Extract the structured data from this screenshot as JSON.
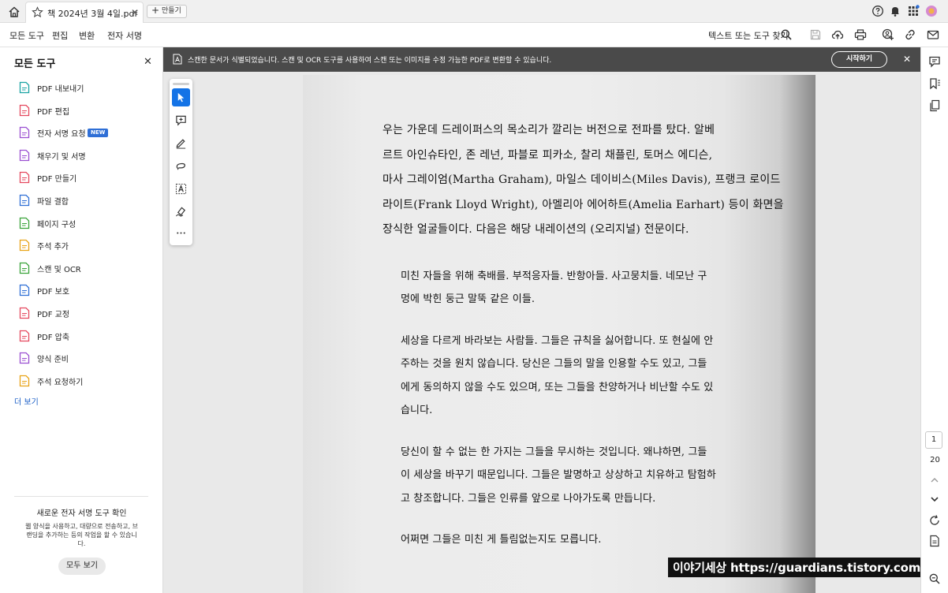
{
  "tabbar": {
    "doc_title": "책 2024년 3월 4일.pdf",
    "new_tab_label": "만들기"
  },
  "menubar": {
    "items": [
      "모든 도구",
      "편집",
      "변환",
      "전자 서명"
    ],
    "find_label": "텍스트 또는 도구 찾기"
  },
  "left_panel": {
    "title": "모든 도구",
    "tools": [
      {
        "label": "PDF 내보내기",
        "icon": "export-pdf-icon",
        "color": "#1aa3a3"
      },
      {
        "label": "PDF 편집",
        "icon": "edit-pdf-icon",
        "color": "#e5495f"
      },
      {
        "label": "전자 서명 요청",
        "icon": "request-esign-icon",
        "color": "#9b4fd1",
        "badge": "NEW"
      },
      {
        "label": "채우기 및 서명",
        "icon": "fill-sign-icon",
        "color": "#9b4fd1"
      },
      {
        "label": "PDF 만들기",
        "icon": "create-pdf-icon",
        "color": "#e5495f"
      },
      {
        "label": "파일 결합",
        "icon": "combine-files-icon",
        "color": "#2f6fd6"
      },
      {
        "label": "페이지 구성",
        "icon": "organize-pages-icon",
        "color": "#3aa33a"
      },
      {
        "label": "주석 추가",
        "icon": "comment-icon",
        "color": "#e8a317"
      },
      {
        "label": "스캔 및 OCR",
        "icon": "scan-ocr-icon",
        "color": "#3aa33a"
      },
      {
        "label": "PDF 보호",
        "icon": "protect-pdf-icon",
        "color": "#2f6fd6"
      },
      {
        "label": "PDF 교정",
        "icon": "redact-pdf-icon",
        "color": "#e5495f"
      },
      {
        "label": "PDF 압축",
        "icon": "compress-pdf-icon",
        "color": "#e5495f"
      },
      {
        "label": "양식 준비",
        "icon": "prepare-form-icon",
        "color": "#9b4fd1"
      },
      {
        "label": "주석 요청하기",
        "icon": "request-comments-icon",
        "color": "#e8a317"
      }
    ],
    "more_label": "더 보기",
    "promo": {
      "title": "새로운 전자 서명 도구 확인",
      "desc": "웹 양식을 사용하고, 대량으로 전송하고, 브랜딩을 추가하는 등의 작업을 할 수 있습니다.",
      "button": "모두 보기"
    }
  },
  "banner": {
    "message": "스캔한 문서가 식별되었습니다. 스캔 및 OCR 도구를 사용하여 스캔 또는 이미지를 수정 가능한 PDF로 변환할 수 있습니다.",
    "button": "시작하기"
  },
  "document": {
    "intro_lines": [
      "우는 가운데 드레이퍼스의 목소리가 깔리는 버전으로 전파를 탔다. 알베",
      "르트 아인슈타인, 존 레넌, 파블로 피카소, 찰리 채플린, 토머스 에디슨,",
      "마사 그레이엄(Martha Graham), 마일스 데이비스(Miles Davis), 프랭크 로이드",
      "라이트(Frank Lloyd Wright), 아멜리아 에어하트(Amelia Earhart) 등이 화면을",
      "장식한 얼굴들이다. 다음은 해당 내레이션의 (오리지널) 전문이다."
    ],
    "paragraphs": [
      [
        "미친 자들을 위해 축배를. 부적응자들. 반항아들. 사고뭉치들. 네모난 구",
        "멍에 박힌 둥근 말뚝 같은 이들."
      ],
      [
        "세상을 다르게 바라보는 사람들. 그들은 규칙을 싫어합니다. 또 현실에 안",
        "주하는 것을 원치 않습니다. 당신은 그들의 말을 인용할 수도 있고, 그들",
        "에게 동의하지 않을 수도 있으며, 또는 그들을 찬양하거나 비난할 수도 있",
        "습니다."
      ],
      [
        "당신이 할 수 없는 한 가지는 그들을 무시하는 것입니다. 왜냐하면, 그들",
        "이 세상을 바꾸기 때문입니다. 그들은 발명하고 상상하고 치유하고 탐험하",
        "고 창조합니다. 그들은 인류를 앞으로 나아가도록 만듭니다."
      ],
      [
        "어쩌면 그들은 미친 게 틀림없는지도 모릅니다."
      ]
    ]
  },
  "quick_tools": [
    "select-tool-icon",
    "add-comment-icon",
    "highlight-pen-icon",
    "draw-freeform-icon",
    "text-box-icon",
    "sign-pen-icon",
    "more-tools-icon"
  ],
  "page_nav": {
    "current": "1",
    "total": "20"
  },
  "watermark": "이야기세상 https://guardians.tistory.com",
  "colors": {
    "accent": "#1473e6",
    "banner_bg": "#4a4a4a",
    "link": "#1a5ec6"
  }
}
